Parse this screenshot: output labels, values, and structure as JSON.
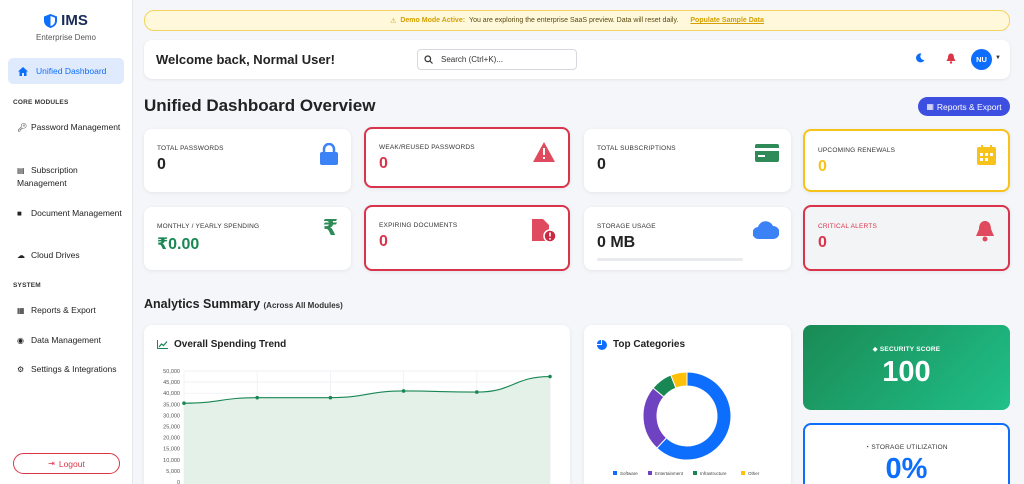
{
  "sidebar": {
    "brand_title": "IMS",
    "brand_sub": "Enterprise Demo",
    "active_item": "Unified Dashboard",
    "section_core": "CORE MODULES",
    "items_core": [
      {
        "label": "Password Management",
        "icon": "key-icon"
      },
      {
        "label": "Subscription Management",
        "icon": "list-icon"
      },
      {
        "label": "Document Management",
        "icon": "folder-icon"
      },
      {
        "label": "Cloud Drives",
        "icon": "cloud-icon"
      }
    ],
    "section_system": "SYSTEM",
    "items_system": [
      {
        "label": "Reports & Export",
        "icon": "file-icon"
      },
      {
        "label": "Data Management",
        "icon": "database-icon"
      },
      {
        "label": "Settings & Integrations",
        "icon": "gear-icon"
      }
    ],
    "logout": "Logout"
  },
  "banner": {
    "strong": "Demo Mode Active:",
    "text": "You are exploring the enterprise SaaS preview. Data will reset daily.",
    "link": "Populate Sample Data"
  },
  "header": {
    "welcome": "Welcome back, Normal User!",
    "search_placeholder": "Search (Ctrl+K)...",
    "avatar": "NU"
  },
  "page": {
    "title": "Unified Dashboard Overview",
    "report_button": "Reports & Export"
  },
  "stats": {
    "total_passwords": {
      "label": "TOTAL PASSWORDS",
      "value": "0"
    },
    "weak_passwords": {
      "label": "WEAK/REUSED PASSWORDS",
      "value": "0"
    },
    "total_subscriptions": {
      "label": "TOTAL SUBSCRIPTIONS",
      "value": "0"
    },
    "upcoming_renewals": {
      "label": "UPCOMING RENEWALS",
      "value": "0"
    },
    "spending": {
      "label": "MONTHLY / YEARLY SPENDING",
      "value": "₹0.00"
    },
    "expiring_docs": {
      "label": "EXPIRING DOCUMENTS",
      "value": "0"
    },
    "storage": {
      "label": "STORAGE USAGE",
      "value": "0 MB",
      "fraction": 0
    },
    "critical_alerts": {
      "label": "CRITICAL ALERTS",
      "value": "0"
    }
  },
  "analytics": {
    "title": "Analytics Summary",
    "subtitle": "(Across All Modules)"
  },
  "spending_chart_title": "Overall Spending Trend",
  "categories_chart_title": "Top Categories",
  "security": {
    "label": "SECURITY SCORE",
    "value": "100"
  },
  "storage_util": {
    "label": "STORAGE UTILIZATION",
    "value": "0%"
  },
  "colors": {
    "primary": "#0d6efd",
    "danger": "#d9344b",
    "warning": "#f7c31a",
    "success": "#198754"
  },
  "chart_data": [
    {
      "type": "area",
      "title": "Overall Spending Trend",
      "y": [
        35500,
        38000,
        38000,
        41000,
        40500,
        47500
      ],
      "ylim": [
        0,
        50000
      ],
      "yticks": [
        "50,000",
        "45,000",
        "40,000",
        "35,000",
        "30,000",
        "25,000",
        "20,000",
        "15,000",
        "10,000",
        "5,000",
        "0"
      ],
      "grid": true
    },
    {
      "type": "pie",
      "title": "Top Categories",
      "labels": [
        "Software",
        "Entertainment",
        "Infrastructure",
        "Other"
      ],
      "values": [
        62,
        24,
        8,
        6
      ],
      "colors": [
        "#0d6efd",
        "#6f42c1",
        "#198754",
        "#ffc107"
      ],
      "legend": "bottom"
    }
  ]
}
